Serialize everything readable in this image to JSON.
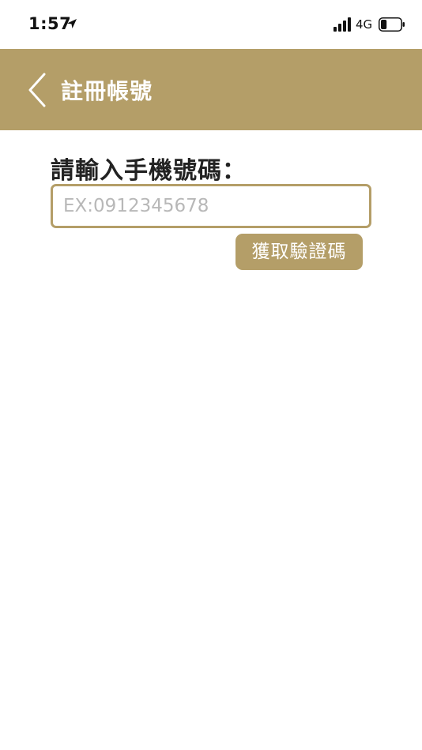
{
  "status_bar": {
    "time": "1:57",
    "network": "4G",
    "battery_level": 0.3
  },
  "nav_bar": {
    "title": "註冊帳號"
  },
  "form": {
    "phone_label": "請輸入手機號碼：",
    "phone_placeholder": "EX:0912345678",
    "phone_value": "",
    "verify_button_label": "獲取驗證碼"
  },
  "colors": {
    "accent": "#b49e68",
    "text": "#222222",
    "placeholder": "#b8b8b8",
    "background": "#ffffff"
  }
}
